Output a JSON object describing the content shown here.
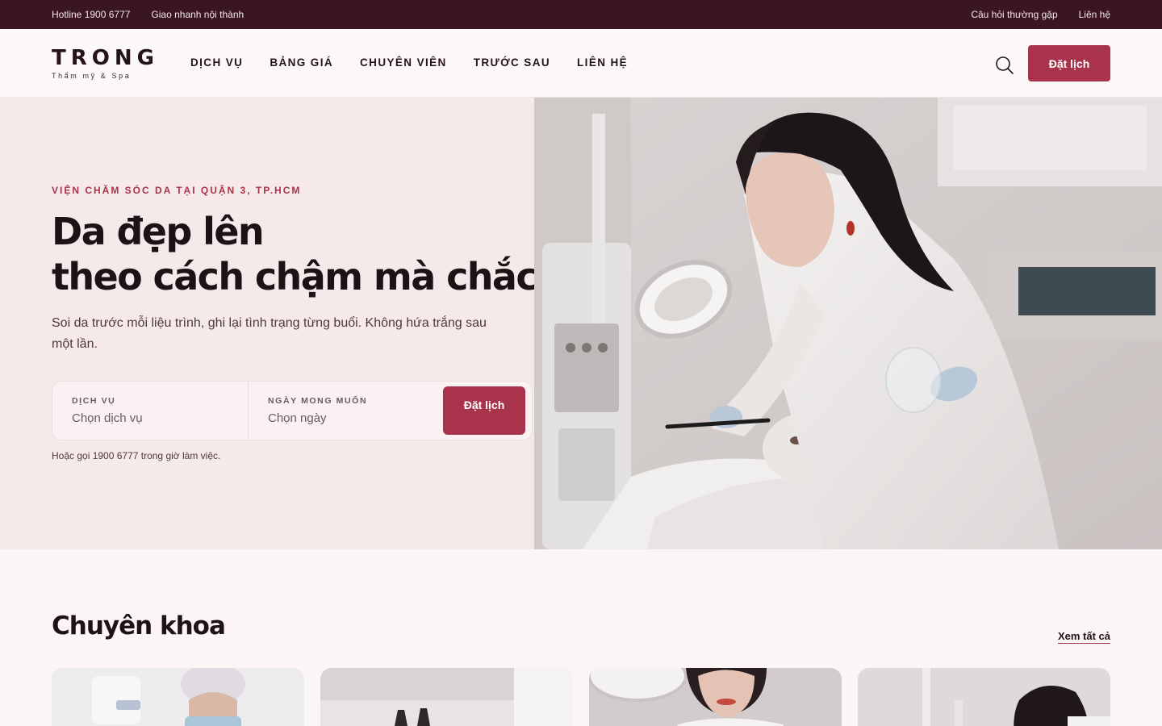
{
  "topbar": {
    "hotline": "Hotline 1900 6777",
    "delivery": "Giao nhanh nội thành",
    "faq": "Câu hỏi thường gặp",
    "contact": "Liên hệ"
  },
  "brand": {
    "name": "TRONG",
    "tagline": "Thẩm mỹ & Spa"
  },
  "nav": {
    "items": [
      {
        "label": "DỊCH VỤ"
      },
      {
        "label": "BẢNG GIÁ"
      },
      {
        "label": "CHUYÊN VIÊN"
      },
      {
        "label": "TRƯỚC SAU"
      },
      {
        "label": "LIÊN HỆ"
      }
    ],
    "book_label": "Đặt lịch"
  },
  "hero": {
    "eyebrow": "VIỆN CHĂM SÓC DA TẠI QUẬN 3, TP.HCM",
    "headline_line1": "Da đẹp lên",
    "headline_line2": "theo cách chậm mà chắc",
    "lead": "Soi da trước mỗi liệu trình, ghi lại tình trạng từng buổi. Không hứa trắng sau một lần.",
    "image_alt": "Chuyên viên chăm sóc da cho khách hàng",
    "booking": {
      "service_label": "DỊCH VỤ",
      "service_placeholder": "Chọn dịch vụ",
      "date_label": "NGÀY MONG MUỐN",
      "date_placeholder": "Chọn ngày",
      "submit_label": "Đặt lịch"
    },
    "note": "Hoặc gọi 1900 6777 trong giờ làm việc."
  },
  "specialties": {
    "title": "Chuyên khoa",
    "view_all": "Xem tất cả"
  },
  "colors": {
    "accent": "#a8334a",
    "topbar": "#3a1620",
    "hero_bg": "#f6e9ea",
    "page_bg": "#fbf5f5"
  },
  "icons": {
    "search": "search-icon"
  }
}
